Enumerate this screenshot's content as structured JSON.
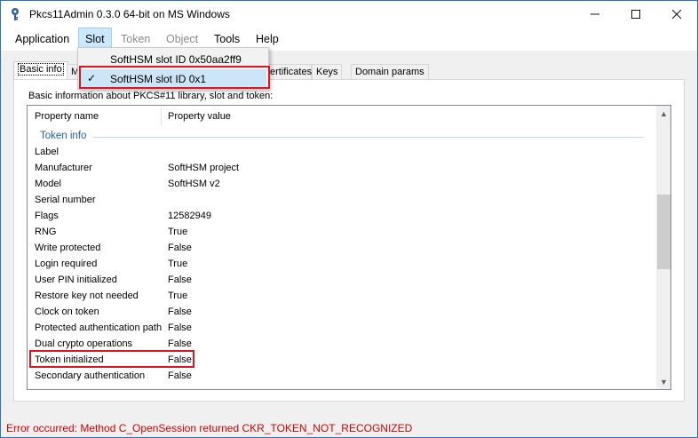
{
  "window": {
    "title": "Pkcs11Admin 0.3.0 64-bit on MS Windows",
    "icon": "key-app-icon",
    "controls": {
      "minimize": "—",
      "maximize": "☐",
      "close": "✕"
    }
  },
  "menu": {
    "items": [
      {
        "label": "Application",
        "state": "enabled"
      },
      {
        "label": "Slot",
        "state": "open"
      },
      {
        "label": "Token",
        "state": "disabled"
      },
      {
        "label": "Object",
        "state": "disabled"
      },
      {
        "label": "Tools",
        "state": "enabled"
      },
      {
        "label": "Help",
        "state": "enabled"
      }
    ]
  },
  "slot_dropdown": {
    "items": [
      {
        "label": "SoftHSM slot ID 0x50aa2ff9",
        "checked": false
      },
      {
        "label": "SoftHSM slot ID 0x1",
        "checked": true
      }
    ],
    "check_glyph": "✓"
  },
  "tabs": {
    "items": [
      "Basic info",
      "M",
      "Certificates",
      "Keys",
      "Domain params"
    ],
    "visible_text": {
      "tab2": "M",
      "tab3": "ertificates"
    },
    "active": "Basic info"
  },
  "panel": {
    "caption": "Basic information about PKCS#11 library, slot and token:",
    "columns": {
      "name": "Property name",
      "value": "Property value"
    },
    "group": "Token info",
    "rows": [
      {
        "name": "Label",
        "value": ""
      },
      {
        "name": "Manufacturer",
        "value": "SoftHSM project"
      },
      {
        "name": "Model",
        "value": "SoftHSM v2"
      },
      {
        "name": "Serial number",
        "value": ""
      },
      {
        "name": "Flags",
        "value": "12582949"
      },
      {
        "name": "RNG",
        "value": "True"
      },
      {
        "name": "Write protected",
        "value": "False"
      },
      {
        "name": "Login required",
        "value": "True"
      },
      {
        "name": "User PIN initialized",
        "value": "False"
      },
      {
        "name": "Restore key not needed",
        "value": "True"
      },
      {
        "name": "Clock on token",
        "value": "False"
      },
      {
        "name": "Protected authentication path",
        "value": "False"
      },
      {
        "name": "Dual crypto operations",
        "value": "False"
      },
      {
        "name": "Token initialized",
        "value": "False"
      },
      {
        "name": "Secondary authentication",
        "value": "False"
      }
    ]
  },
  "scrollbar": {
    "up": "▲",
    "down": "▼"
  },
  "status": {
    "message": "Error occurred: Method C_OpenSession returned CKR_TOKEN_NOT_RECOGNIZED",
    "color": "#d40000"
  },
  "colors": {
    "highlight": "#e0141e",
    "group_label": "#1e5fb4",
    "menu_open": "#cce8ff"
  }
}
